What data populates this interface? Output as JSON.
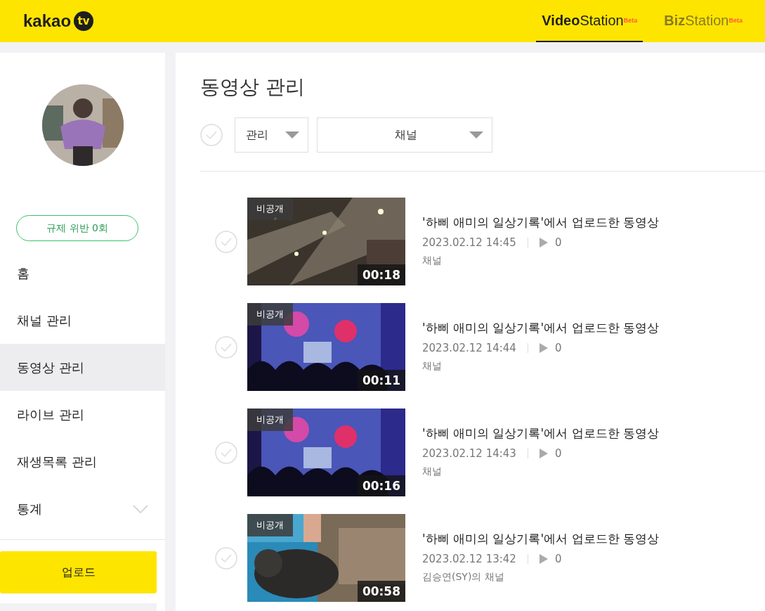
{
  "header": {
    "logo": "kakao",
    "logo_badge": "tv",
    "tabs": [
      {
        "label": "**Video**Station$^{Beta}$",
        "selected": true
      },
      {
        "label": "**Biz**Station$^{Beta}$",
        "selected": false
      }
    ]
  },
  "sidebar": {
    "violations": "규제 위반 0회",
    "items": [
      {
        "label": "홈",
        "selected": false
      },
      {
        "label": "채널 관리",
        "selected": false
      },
      {
        "label": "동영상 관리",
        "selected": true
      },
      {
        "label": "라이브 관리",
        "selected": false
      },
      {
        "label": "재생목록 관리",
        "selected": false
      },
      {
        "label": "통계",
        "selected": false,
        "expanded": false
      }
    ],
    "upload": "업로드"
  },
  "main": {
    "title": "동영상 관리",
    "select_all_checked": false,
    "filters": [
      {
        "label": "관리",
        "kind": "narrow"
      },
      {
        "label": "채널",
        "kind": "wide"
      }
    ],
    "videos": [
      {
        "badge": "비공개",
        "duration": "00:18",
        "title": "'하삐 애미의 일상기록'에서 업로드한 동영상",
        "date": "2023.02.12 14:45",
        "plays": "0",
        "channel": "채널",
        "checked": false,
        "kind": "concert"
      },
      {
        "badge": "비공개",
        "duration": "00:11",
        "title": "'하삐 애미의 일상기록'에서 업로드한 동영상",
        "date": "2023.02.12 14:44",
        "plays": "0",
        "channel": "채널",
        "checked": false,
        "kind": "stage"
      },
      {
        "badge": "비공개",
        "duration": "00:16",
        "title": "'하삐 애미의 일상기록'에서 업로드한 동영상",
        "date": "2023.02.12 14:43",
        "plays": "0",
        "channel": "채널",
        "checked": false,
        "kind": "stage"
      },
      {
        "badge": "비공개",
        "duration": "00:58",
        "title": "'하삐 애미의 일상기록'에서 업로드한 동영상",
        "date": "2023.02.12 13:42",
        "plays": "0",
        "channel": "김승연(SY)의 채널",
        "checked": false,
        "kind": "seal"
      }
    ]
  }
}
